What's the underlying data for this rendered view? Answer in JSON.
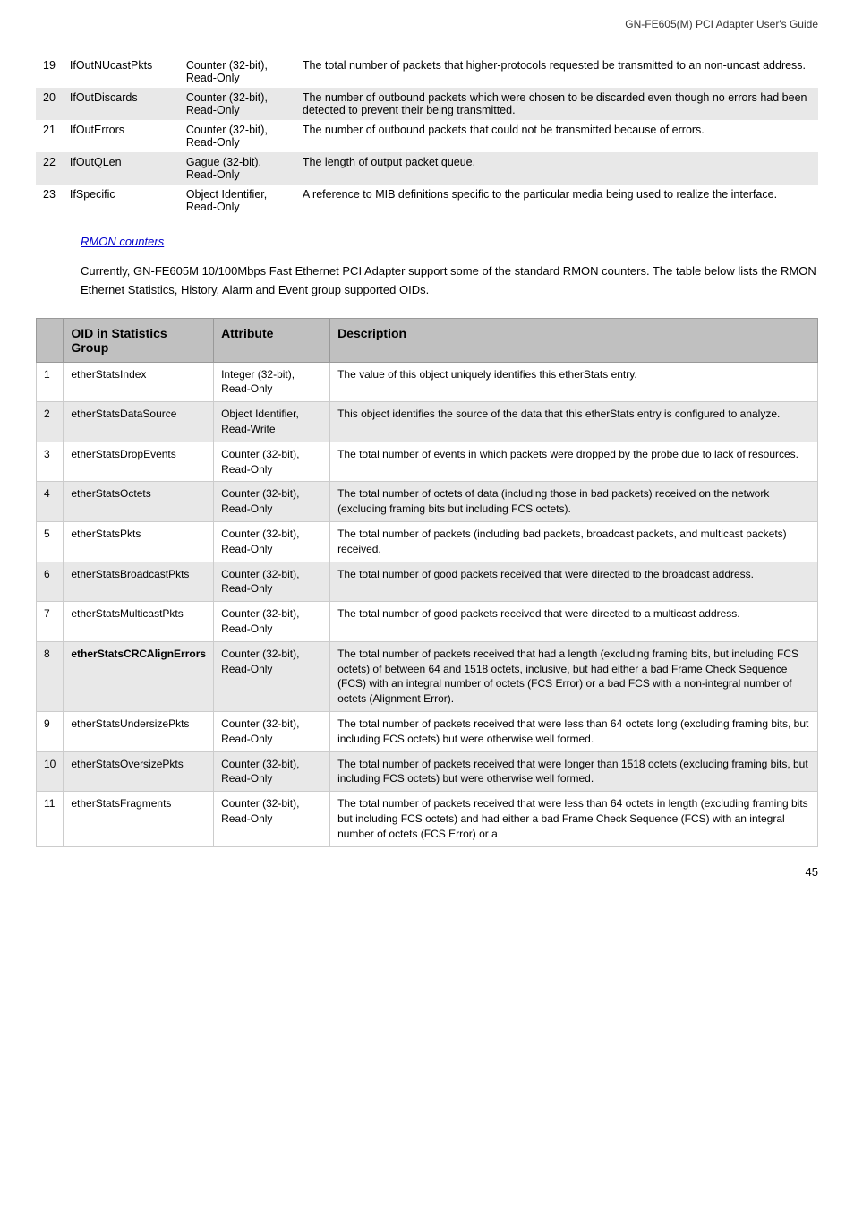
{
  "header": {
    "title": "GN-FE605(M) PCI Adapter User's Guide"
  },
  "top_table": {
    "rows": [
      {
        "num": "19",
        "name": "IfOutNUcastPkts",
        "attribute": "Counter (32-bit), Read-Only",
        "description": "The total number of packets that higher-protocols requested be transmitted to an non-uncast address."
      },
      {
        "num": "20",
        "name": "IfOutDiscards",
        "attribute": "Counter (32-bit), Read-Only",
        "description": "The number of outbound packets which were chosen to be discarded even though no errors had been detected to prevent their being transmitted."
      },
      {
        "num": "21",
        "name": "IfOutErrors",
        "attribute": "Counter (32-bit), Read-Only",
        "description": "The number of outbound packets that could not be transmitted because of errors."
      },
      {
        "num": "22",
        "name": "IfOutQLen",
        "attribute": "Gague (32-bit), Read-Only",
        "description": "The length of output packet queue."
      },
      {
        "num": "23",
        "name": "IfSpecific",
        "attribute": "Object Identifier, Read-Only",
        "description": "A reference to MIB definitions specific to the particular media being used to realize the interface."
      }
    ]
  },
  "rmon_link": "RMON counters",
  "paragraph": "Currently, GN-FE605M 10/100Mbps Fast Ethernet PCI Adapter support some of the standard RMON counters. The table below lists the RMON Ethernet Statistics, History, Alarm and Event group supported OIDs.",
  "main_table": {
    "headers": {
      "oid": "OID in Statistics Group",
      "attribute": "Attribute",
      "description": "Description"
    },
    "rows": [
      {
        "num": "1",
        "oid": "etherStatsIndex",
        "attribute": "Integer (32-bit), Read-Only",
        "description": "The value of this object uniquely identifies this etherStats entry.",
        "bold": false
      },
      {
        "num": "2",
        "oid": "etherStatsDataSource",
        "attribute": "Object Identifier, Read-Write",
        "description": "This object identifies the source of the data that this etherStats entry is configured to analyze.",
        "bold": false
      },
      {
        "num": "3",
        "oid": "etherStatsDropEvents",
        "attribute": "Counter (32-bit), Read-Only",
        "description": "The total number of events in which packets were dropped by the probe due to lack of resources.",
        "bold": false
      },
      {
        "num": "4",
        "oid": "etherStatsOctets",
        "attribute": "Counter (32-bit), Read-Only",
        "description": "The total number of octets of data (including those in bad packets) received on the network (excluding framing bits but including FCS octets).",
        "bold": false
      },
      {
        "num": "5",
        "oid": "etherStatsPkts",
        "attribute": "Counter (32-bit), Read-Only",
        "description": "The total number of packets (including bad packets, broadcast packets, and multicast packets) received.",
        "bold": false
      },
      {
        "num": "6",
        "oid": "etherStatsBroadcastPkts",
        "attribute": "Counter (32-bit), Read-Only",
        "description": "The total number of good packets received that were directed to the broadcast address.",
        "bold": false
      },
      {
        "num": "7",
        "oid": "etherStatsMulticastPkts",
        "attribute": "Counter (32-bit), Read-Only",
        "description": "The total number of good packets received that were directed to a multicast address.",
        "bold": false
      },
      {
        "num": "8",
        "oid": "etherStatsCRCAlignErrors",
        "attribute": "Counter (32-bit), Read-Only",
        "description": "The total number of packets received that had a length (excluding framing bits, but including FCS octets) of between 64 and 1518 octets, inclusive, but had either a bad Frame Check Sequence (FCS) with an integral number of octets (FCS Error) or a bad FCS with a non-integral number of octets (Alignment Error).",
        "bold": true
      },
      {
        "num": "9",
        "oid": "etherStatsUndersizePkts",
        "attribute": "Counter (32-bit), Read-Only",
        "description": "The total number of packets received that were less than 64 octets long (excluding framing bits, but including FCS octets) but were otherwise well formed.",
        "bold": false
      },
      {
        "num": "10",
        "oid": "etherStatsOversizePkts",
        "attribute": "Counter (32-bit), Read-Only",
        "description": "The total number of packets received that were longer than 1518 octets (excluding framing bits, but including FCS octets) but were otherwise well formed.",
        "bold": false
      },
      {
        "num": "11",
        "oid": "etherStatsFragments",
        "attribute": "Counter (32-bit), Read-Only",
        "description": "The total number of packets received that were less than 64 octets in length (excluding framing bits but including FCS octets) and had either a bad Frame Check Sequence (FCS) with an integral number of octets (FCS Error) or a",
        "bold": false
      }
    ]
  },
  "page_number": "45"
}
